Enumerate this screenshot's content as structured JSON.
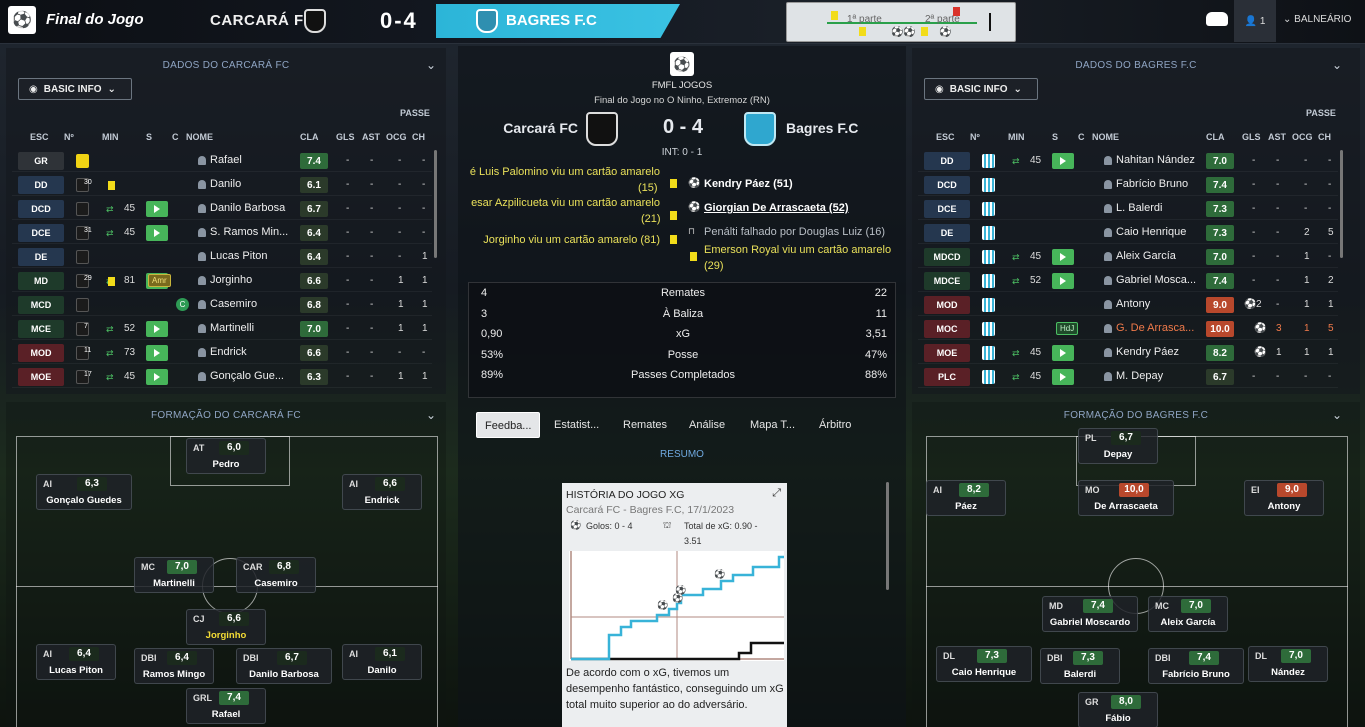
{
  "topbar": {
    "title": "Final do Jogo",
    "home_team": "CARCARÁ FC",
    "score": "0-4",
    "away_team": "BAGRES F.C",
    "half1": "1ª parte",
    "half2": "2ª parte",
    "users": "1",
    "room": "BALNEÁRIO"
  },
  "left": {
    "header": "DADOS DO CARCARÁ FC",
    "view": "BASIC INFO",
    "passe": "PASSE",
    "cols": [
      "ESC",
      "Nº",
      "MIN",
      "S",
      "C",
      "NOME",
      "CLA",
      "GLS",
      "AST",
      "OCG",
      "CH"
    ],
    "rows": [
      {
        "pos": "GR",
        "num": "",
        "min": "",
        "name": "Rafael",
        "cla": "7.4",
        "gls": "-",
        "ast": "-",
        "ocg": "-",
        "ch": "-"
      },
      {
        "pos": "DD",
        "num": "30",
        "min": "",
        "name": "Danilo",
        "cla": "6.1",
        "gls": "-",
        "ast": "-",
        "ocg": "-",
        "ch": "-"
      },
      {
        "pos": "DCD",
        "num": "",
        "min": "45",
        "name": "Danilo Barbosa",
        "cla": "6.7",
        "gls": "-",
        "ast": "-",
        "ocg": "-",
        "ch": "-"
      },
      {
        "pos": "DCE",
        "num": "31",
        "min": "45",
        "name": "S. Ramos Min...",
        "cla": "6.4",
        "gls": "-",
        "ast": "-",
        "ocg": "-",
        "ch": "-"
      },
      {
        "pos": "DE",
        "num": "",
        "min": "",
        "name": "Lucas Piton",
        "cla": "6.4",
        "gls": "-",
        "ast": "-",
        "ocg": "-",
        "ch": "1"
      },
      {
        "pos": "MD",
        "num": "29",
        "min": "81",
        "name": "Jorginho",
        "cla": "6.6",
        "gls": "-",
        "ast": "-",
        "ocg": "1",
        "ch": "1",
        "status": "Amr"
      },
      {
        "pos": "MCD",
        "num": "",
        "min": "",
        "name": "Casemiro",
        "cla": "6.8",
        "gls": "-",
        "ast": "-",
        "ocg": "1",
        "ch": "1",
        "status": "C"
      },
      {
        "pos": "MCE",
        "num": "7",
        "min": "52",
        "name": "Martinelli",
        "cla": "7.0",
        "gls": "-",
        "ast": "-",
        "ocg": "1",
        "ch": "1"
      },
      {
        "pos": "MOD",
        "num": "11",
        "min": "73",
        "name": "Endrick",
        "cla": "6.6",
        "gls": "-",
        "ast": "-",
        "ocg": "-",
        "ch": "-"
      },
      {
        "pos": "MOE",
        "num": "17",
        "min": "45",
        "name": "Gonçalo Gue...",
        "cla": "6.3",
        "gls": "-",
        "ast": "-",
        "ocg": "1",
        "ch": "1"
      }
    ],
    "formation_header": "FORMAÇÃO DO CARCARÁ FC",
    "formation": [
      {
        "pos": "AT",
        "rating": "6,0",
        "name": "Pedro"
      },
      {
        "pos": "AI",
        "rating": "6,3",
        "name": "Gonçalo Guedes"
      },
      {
        "pos": "AI",
        "rating": "6,6",
        "name": "Endrick"
      },
      {
        "pos": "MC",
        "rating": "7,0",
        "name": "Martinelli"
      },
      {
        "pos": "CAR",
        "rating": "6,8",
        "name": "Casemiro"
      },
      {
        "pos": "CJ",
        "rating": "6,6",
        "name": "Jorginho"
      },
      {
        "pos": "AI",
        "rating": "6,4",
        "name": "Lucas Piton"
      },
      {
        "pos": "DBI",
        "rating": "6,4",
        "name": "Ramos Mingo"
      },
      {
        "pos": "DBI",
        "rating": "6,7",
        "name": "Danilo Barbosa"
      },
      {
        "pos": "AI",
        "rating": "6,1",
        "name": "Danilo"
      },
      {
        "pos": "GRL",
        "rating": "7,4",
        "name": "Rafael"
      }
    ]
  },
  "right": {
    "header": "DADOS DO BAGRES F.C",
    "view": "BASIC INFO",
    "passe": "PASSE",
    "cols": [
      "ESC",
      "Nº",
      "MIN",
      "S",
      "C",
      "NOME",
      "CLA",
      "GLS",
      "AST",
      "OCG",
      "CH"
    ],
    "rows": [
      {
        "pos": "DD",
        "min": "45",
        "name": "Nahitan Nández",
        "cla": "7.0",
        "gls": "-",
        "ast": "-",
        "ocg": "-",
        "ch": "-"
      },
      {
        "pos": "DCD",
        "min": "",
        "name": "Fabrício Bruno",
        "cla": "7.4",
        "gls": "-",
        "ast": "-",
        "ocg": "-",
        "ch": "-"
      },
      {
        "pos": "DCE",
        "min": "",
        "name": "L. Balerdi",
        "cla": "7.3",
        "gls": "-",
        "ast": "-",
        "ocg": "-",
        "ch": "-"
      },
      {
        "pos": "DE",
        "min": "",
        "name": "Caio Henrique",
        "cla": "7.3",
        "gls": "-",
        "ast": "-",
        "ocg": "2",
        "ch": "5"
      },
      {
        "pos": "MDCD",
        "min": "45",
        "name": "Aleix García",
        "cla": "7.0",
        "gls": "-",
        "ast": "-",
        "ocg": "1",
        "ch": "-"
      },
      {
        "pos": "MDCE",
        "min": "52",
        "name": "Gabriel Mosca...",
        "cla": "7.4",
        "gls": "-",
        "ast": "-",
        "ocg": "1",
        "ch": "2"
      },
      {
        "pos": "MOD",
        "min": "",
        "name": "Antony",
        "cla": "9.0",
        "gls": "2",
        "ast": "-",
        "ocg": "1",
        "ch": "1"
      },
      {
        "pos": "MOC",
        "min": "",
        "name": "G. De Arrasca...",
        "cla": "10.0",
        "gls": "",
        "ast": "3",
        "ocg": "1",
        "ch": "5",
        "status": "HdJ"
      },
      {
        "pos": "MOE",
        "min": "45",
        "name": "Kendry Páez",
        "cla": "8.2",
        "gls": "",
        "ast": "1",
        "ocg": "1",
        "ch": "1"
      },
      {
        "pos": "PLC",
        "min": "45",
        "name": "M. Depay",
        "cla": "6.7",
        "gls": "-",
        "ast": "-",
        "ocg": "-",
        "ch": "-"
      }
    ],
    "formation_header": "FORMAÇÃO DO BAGRES F.C",
    "formation": [
      {
        "pos": "PL",
        "rating": "6,7",
        "name": "Depay"
      },
      {
        "pos": "AI",
        "rating": "8,2",
        "name": "Páez"
      },
      {
        "pos": "MO",
        "rating": "10,0",
        "name": "De Arrascaeta"
      },
      {
        "pos": "EI",
        "rating": "9,0",
        "name": "Antony"
      },
      {
        "pos": "MD",
        "rating": "7,4",
        "name": "Gabriel Moscardo"
      },
      {
        "pos": "MC",
        "rating": "7,0",
        "name": "Aleix García"
      },
      {
        "pos": "DL",
        "rating": "7,3",
        "name": "Caio Henrique"
      },
      {
        "pos": "DBI",
        "rating": "7,3",
        "name": "Balerdi"
      },
      {
        "pos": "DBI",
        "rating": "7,4",
        "name": "Fabrício Bruno"
      },
      {
        "pos": "DL",
        "rating": "7,0",
        "name": "Nández"
      },
      {
        "pos": "GR",
        "rating": "8,0",
        "name": "Fábio"
      }
    ]
  },
  "center": {
    "competition": "FMFL JOGOS",
    "subtitle": "Final do Jogo no O Ninho, Extremoz (RN)",
    "home": "Carcará FC",
    "away": "Bagres F.C",
    "score": "0 - 4",
    "ht": "INT: 0 - 1",
    "events_home": [
      "é Luis Palomino viu um cartão amarelo",
      "(15)",
      "esar Azpilicueta viu um cartão amarelo",
      "(21)",
      "Jorginho viu um cartão amarelo (81)"
    ],
    "events_away": [
      "Kendry Páez (51)",
      "Giorgian De Arrascaeta (52)",
      "Penálti falhado por Douglas Luiz (16)",
      "Emerson Royal viu um cartão amarelo",
      "(29)"
    ],
    "stats": [
      {
        "h": "4",
        "label": "Remates",
        "a": "22"
      },
      {
        "h": "3",
        "label": "À Baliza",
        "a": "11"
      },
      {
        "h": "0,90",
        "label": "xG",
        "a": "3,51"
      },
      {
        "h": "53%",
        "label": "Posse",
        "a": "47%"
      },
      {
        "h": "89%",
        "label": "Passes Completados",
        "a": "88%"
      }
    ],
    "tabs": [
      "Feedba...",
      "Estatist...",
      "Remates",
      "Análise",
      "Mapa T...",
      "Árbitro"
    ],
    "resumo": "RESUMO",
    "card": {
      "title": "HISTÓRIA DO JOGO XG",
      "sub": "Carcará FC - Bagres F.C, 17/1/2023",
      "goals": "Golos: 0 - 4",
      "xg_a": "Total de xG: 0.90 -",
      "xg_b": "3.51",
      "text": "De acordo com o xG, tivemos um desempenho fantástico, conseguindo um xG total muito superior ao do adversário."
    }
  },
  "colors": {
    "accent": "#3ac2e3",
    "green": "#47b55a",
    "yellow": "#f2dc1a",
    "red": "#b8482c"
  }
}
